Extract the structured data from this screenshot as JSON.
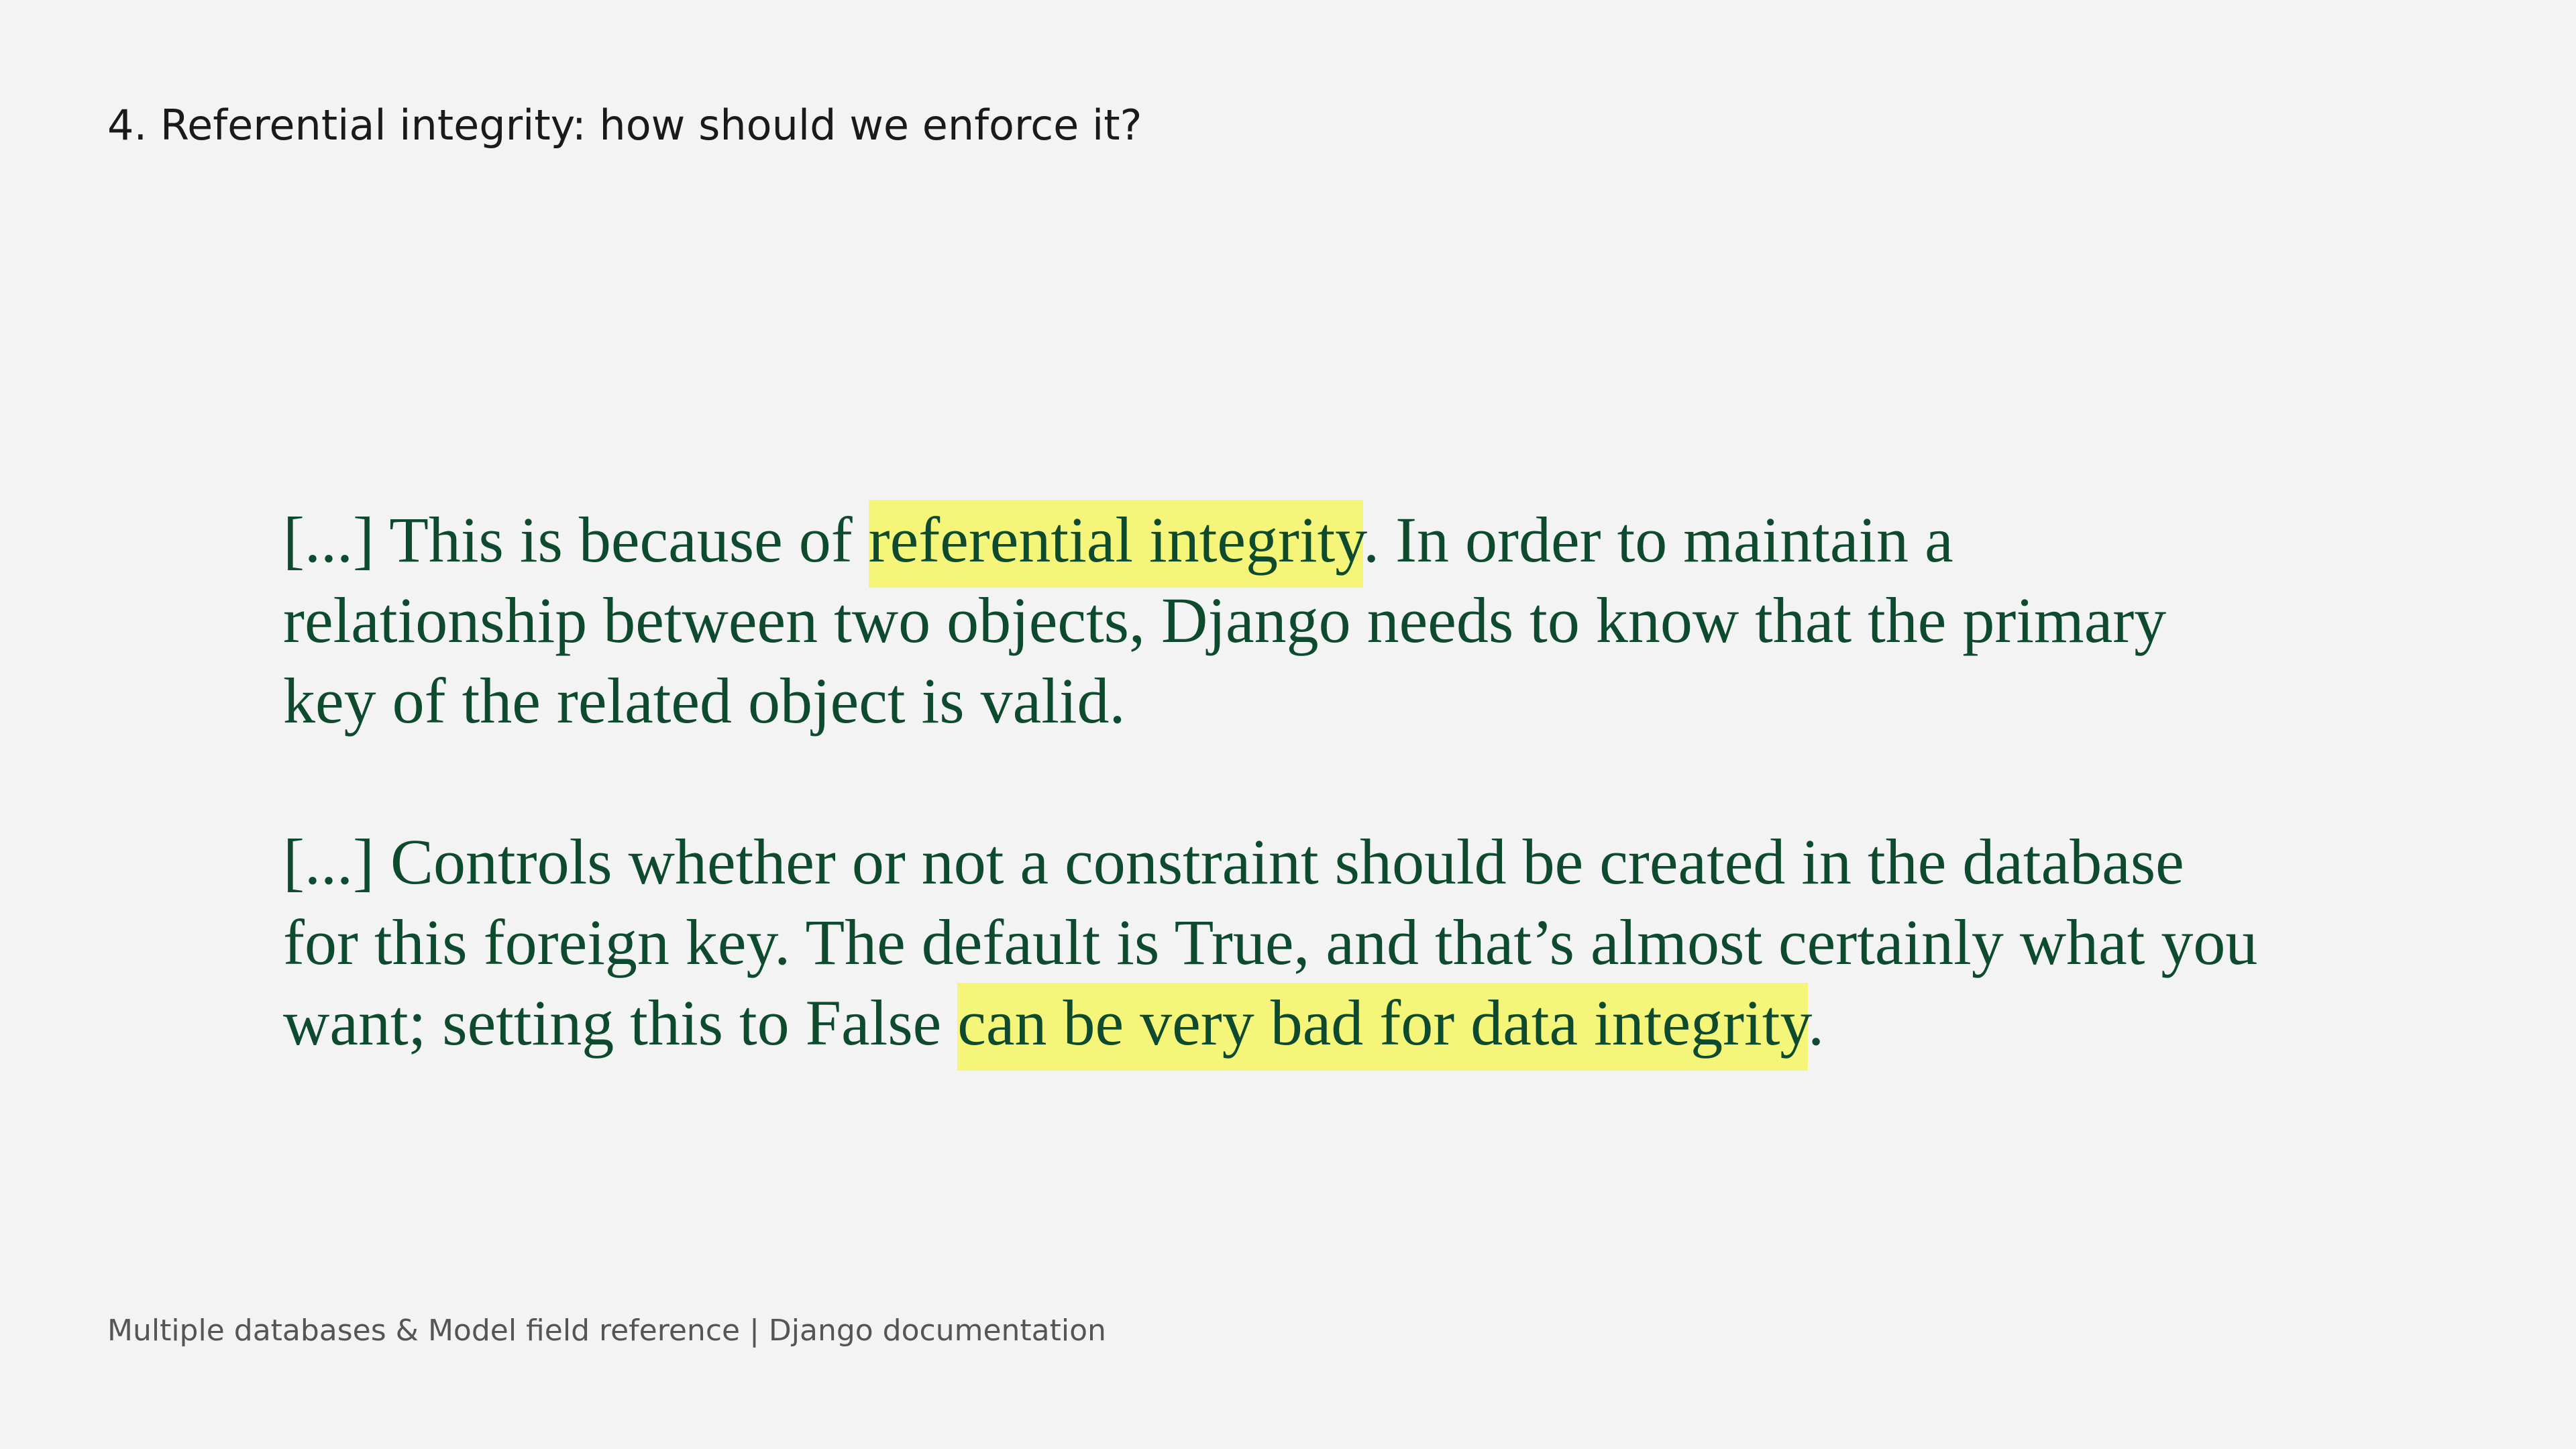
{
  "slide": {
    "title": "4. Referential integrity: how should we enforce it?",
    "quotes": [
      {
        "before": "[...] This is because of ",
        "highlight": "referential integrity",
        "after": ". In order to maintain a relationship between two objects, Django needs to know that the primary key of the related object is valid."
      },
      {
        "before": "[...] Controls whether or not a constraint should be created in the database for this foreign key. The default is True, and that’s almost certainly what you want; setting this to False ",
        "highlight": "can be very bad for data integrity",
        "after": "."
      }
    ],
    "source": "Multiple databases & Model field reference | Django documentation"
  },
  "colors": {
    "background": "#f3f3f3",
    "quote_text": "#0d4a2e",
    "highlight": "#f5f57a"
  }
}
